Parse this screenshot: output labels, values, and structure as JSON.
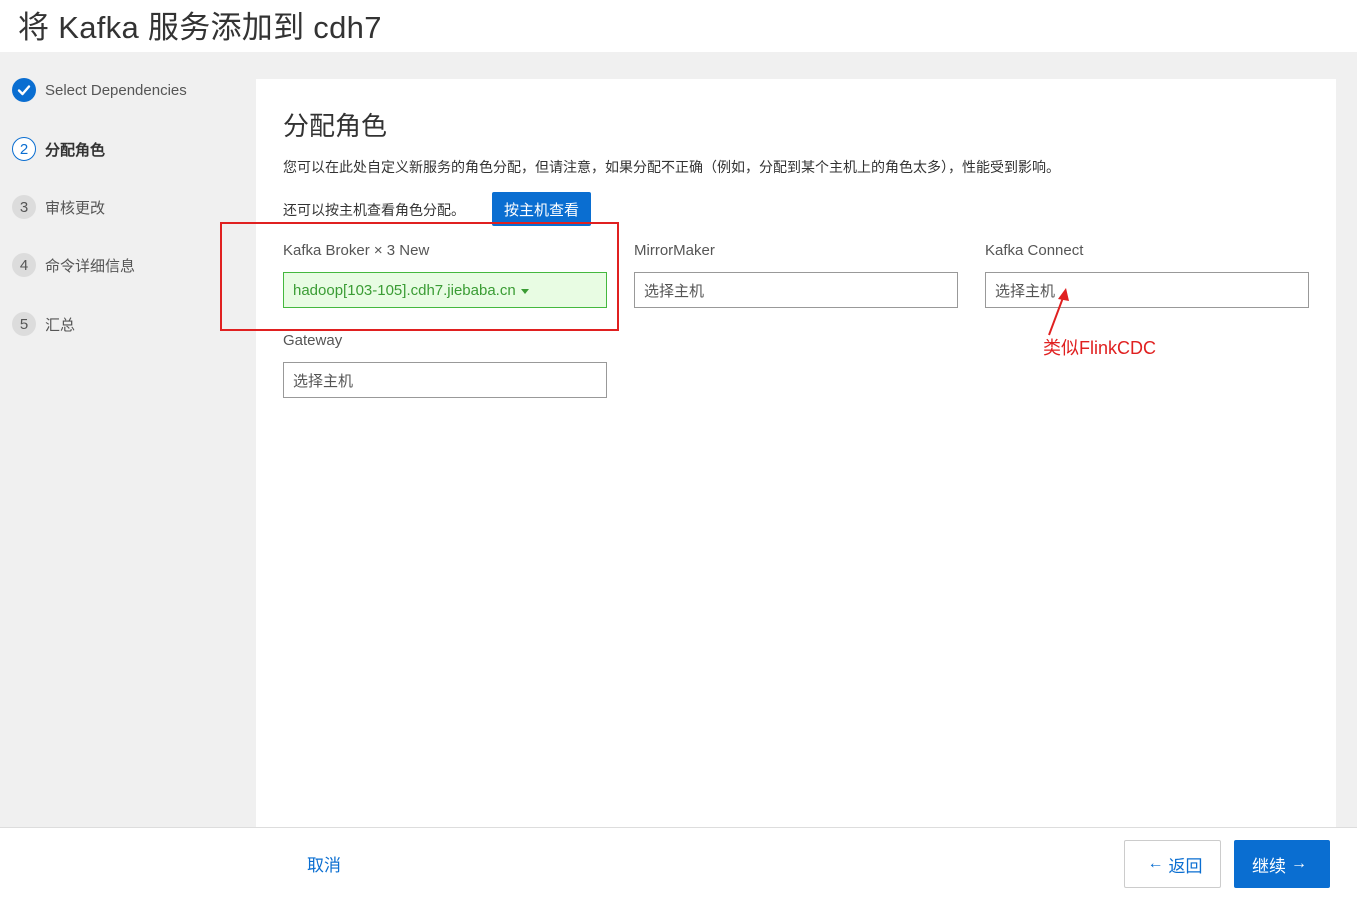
{
  "header": {
    "title": "将 Kafka 服务添加到 cdh7"
  },
  "steps": [
    {
      "number": "",
      "label": "Select Dependencies",
      "state": "done"
    },
    {
      "number": "2",
      "label": "分配角色",
      "state": "active"
    },
    {
      "number": "3",
      "label": "审核更改",
      "state": "pending"
    },
    {
      "number": "4",
      "label": "命令详细信息",
      "state": "pending"
    },
    {
      "number": "5",
      "label": "汇总",
      "state": "pending"
    }
  ],
  "main": {
    "title": "分配角色",
    "description": "您可以在此处自定义新服务的角色分配，但请注意，如果分配不正确（例如，分配到某个主机上的角色太多），性能受到影响。",
    "view_by_host_text": "还可以按主机查看角色分配。",
    "view_by_host_button": "按主机查看",
    "roles": [
      {
        "label": "Kafka Broker × 3 New",
        "value": "hadoop[103-105].cdh7.jiebaba.cn",
        "assigned": true
      },
      {
        "label": "MirrorMaker",
        "value": "选择主机",
        "assigned": false
      },
      {
        "label": "Kafka Connect",
        "value": "选择主机",
        "assigned": false
      },
      {
        "label": "Gateway",
        "value": "选择主机",
        "assigned": false
      }
    ],
    "annotation": "类似FlinkCDC"
  },
  "footer": {
    "cancel": "取消",
    "back": "返回",
    "continue": "继续"
  },
  "colors": {
    "primary": "#0a6ed1",
    "assigned_bg": "#e8fce3",
    "assigned_text": "#3a9c34",
    "annotation_red": "#e02020"
  }
}
